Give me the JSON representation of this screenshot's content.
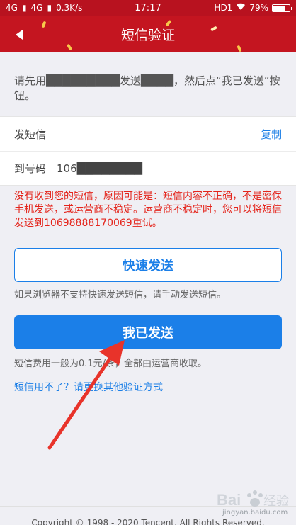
{
  "status_bar": {
    "signal1": "4G",
    "signal2": "4G",
    "network_speed": "0.3K/s",
    "time": "17:17",
    "hd_label": "HD1",
    "battery": "79%",
    "battery_level": 0.79
  },
  "nav": {
    "title": "短信验证"
  },
  "instructions": "请先用█████████发送████，然后点“我已发送”按钮。",
  "info": {
    "send_label": "发短信",
    "send_value": "",
    "copy_label": "复制",
    "to_label": "到号码",
    "to_value": "106████████"
  },
  "error_text": "没有收到您的短信，原因可能是：短信内容不正确，不是密保手机发送，或运营商不稳定。运营商不稳定时，您可以将短信发送到10698888170069重试。",
  "quick_send": {
    "label": "快速发送",
    "note": "如果浏览器不支持快速发送短信，请手动发送短信。"
  },
  "sent": {
    "label": "我已发送",
    "note": "短信费用一般为0.1元/条，全部由运营商收取。"
  },
  "switch_link": "短信用不了？请更换其他验证方式",
  "footer": {
    "copyright": "Copyright © 1998 - 2020 Tencent. All Rights Reserved."
  },
  "watermark": {
    "text": "jingyan.baidu.com"
  },
  "colors": {
    "header_red": "#c41520",
    "primary_blue": "#1b7fe8",
    "error_red": "#e4241b",
    "arrow_red": "#e8332a"
  }
}
